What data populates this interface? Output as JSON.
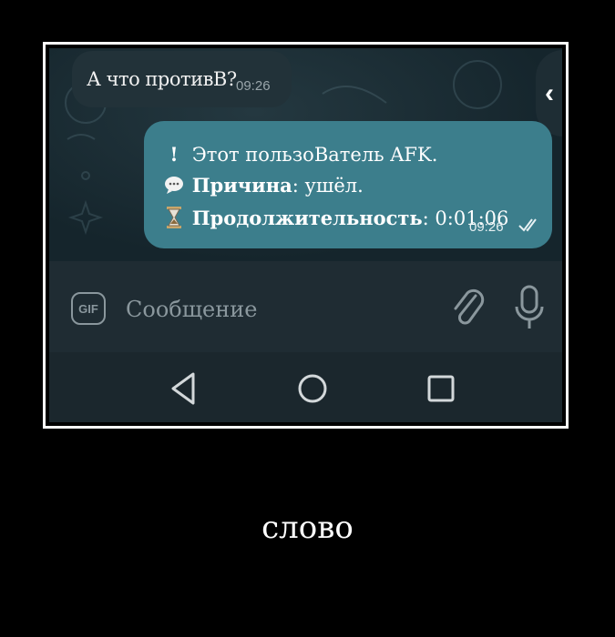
{
  "chat": {
    "incoming": {
      "text": "А что противВ?",
      "time": "09:26"
    },
    "outgoing": {
      "line1": {
        "icon": "!",
        "text": "Этот пользоВатель AFK."
      },
      "line2": {
        "icon": "speech-bubble",
        "label": "Причина",
        "sep": ":",
        "value": " ушёл."
      },
      "line3": {
        "icon": "hourglass",
        "label": "Продолжительность",
        "sep": ":",
        "value": " 0:01:06"
      },
      "time": "09:26",
      "status": "read"
    }
  },
  "back": {
    "icon": "chevron-left",
    "glyph": "‹"
  },
  "input": {
    "gif_label": "GIF",
    "placeholder": "Сообщение",
    "attach_icon": "paperclip",
    "mic_icon": "microphone"
  },
  "nav": {
    "back_icon": "triangle-back",
    "home_icon": "circle-home",
    "recents_icon": "square-recents"
  },
  "caption": "слово",
  "colors": {
    "background": "#000000",
    "frame": "#ffffff",
    "chat_bg": "#15252c",
    "incoming_bubble": "#223239",
    "outgoing_bubble": "#3c7e8c",
    "input_bar": "#1f2c33",
    "nav_bar": "#1b272d"
  }
}
